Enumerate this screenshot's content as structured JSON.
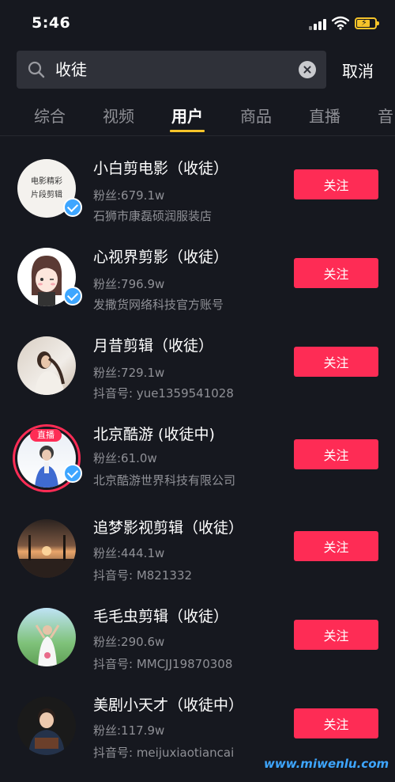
{
  "status_bar": {
    "time": "5:46"
  },
  "search": {
    "query": "收徒",
    "cancel_label": "取消"
  },
  "tabs": [
    {
      "label": "综合"
    },
    {
      "label": "视频"
    },
    {
      "label": "用户"
    },
    {
      "label": "商品"
    },
    {
      "label": "直播"
    },
    {
      "label": "音"
    }
  ],
  "active_tab": "用户",
  "results": [
    {
      "name": "小白剪电影（收徒）",
      "fans": "粉丝:679.1w",
      "desc": "石狮市康磊硕润服装店",
      "verified": true,
      "follow_label": "关注",
      "avatar_text_line1": "电影精彩",
      "avatar_text_line2": "片段剪辑"
    },
    {
      "name": "心视界剪影（收徒）",
      "fans": "粉丝:796.9w",
      "desc": "发撒货网络科技官方账号",
      "verified": true,
      "follow_label": "关注"
    },
    {
      "name": "月昔剪辑（收徒）",
      "fans": "粉丝:729.1w",
      "desc": "抖音号: yue1359541028",
      "verified": false,
      "follow_label": "关注"
    },
    {
      "name": "北京酷游 (收徒中)",
      "fans": "粉丝:61.0w",
      "desc": "北京酷游世界科技有限公司",
      "verified": true,
      "live": true,
      "live_label": "直播",
      "follow_label": "关注"
    },
    {
      "name": "追梦影视剪辑（收徒）",
      "fans": "粉丝:444.1w",
      "desc": "抖音号: M821332",
      "verified": false,
      "follow_label": "关注"
    },
    {
      "name": "毛毛虫剪辑（收徒）",
      "fans": "粉丝:290.6w",
      "desc": "抖音号: MMCJJ19870308",
      "verified": false,
      "follow_label": "关注"
    },
    {
      "name": "美剧小天才（收徒中）",
      "fans": "粉丝:117.9w",
      "desc": "抖音号: meijuxiaotiancai",
      "verified": false,
      "follow_label": "关注"
    }
  ],
  "watermark": "www.miwenlu.com",
  "colors": {
    "background": "#16181f",
    "follow": "#fe2c55",
    "tab_indicator": "#f6c42a",
    "verify": "#3ea6ff"
  }
}
